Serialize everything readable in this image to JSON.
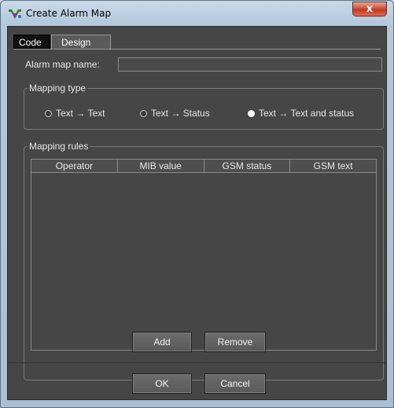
{
  "window": {
    "title": "Create Alarm Map",
    "close_label": "x"
  },
  "tabs": [
    {
      "label": "Code",
      "active": false
    },
    {
      "label": "Design",
      "active": true
    }
  ],
  "form": {
    "name_label": "Alarm map name:",
    "name_value": ""
  },
  "mapping_type": {
    "legend": "Mapping type",
    "options": [
      {
        "label": "Text → Text",
        "checked": false
      },
      {
        "label": "Text → Status",
        "checked": false
      },
      {
        "label": "Text → Text and status",
        "checked": true
      }
    ]
  },
  "mapping_rules": {
    "legend": "Mapping rules",
    "columns": [
      "Operator",
      "MIB value",
      "GSM status",
      "GSM text"
    ],
    "rows": [],
    "add_label": "Add",
    "remove_label": "Remove"
  },
  "footer": {
    "ok_label": "OK",
    "cancel_label": "Cancel"
  },
  "colors": {
    "panel_bg": "#464646",
    "close_button": "#c2381f"
  }
}
